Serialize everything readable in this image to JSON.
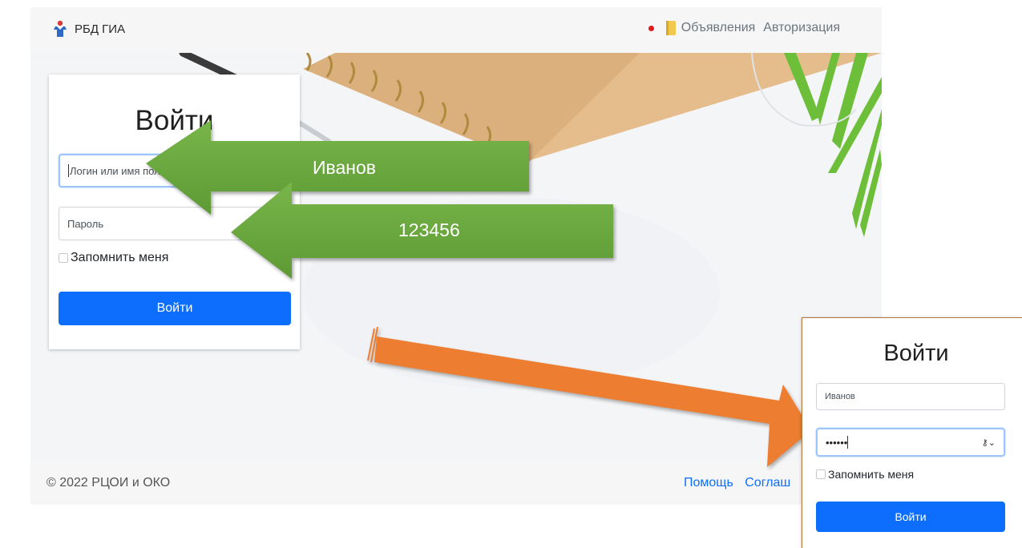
{
  "navbar": {
    "brand": "РБД ГИА",
    "links": [
      "Объявления",
      "Авторизация"
    ],
    "colors": {
      "dot": "#e21a1a",
      "link": "#6c757d"
    }
  },
  "login_card": {
    "title": "Войти",
    "login_placeholder": "Логин или имя пользователя",
    "password_placeholder": "Пароль",
    "remember": "Запомнить меня",
    "submit": "Войти"
  },
  "footer": {
    "copyright": "© 2022 РЦОИ и ОКО",
    "links": [
      "Помощь",
      "Соглаш"
    ]
  },
  "annotations": {
    "login_hint": "Иванов",
    "password_hint": "123456",
    "colors": {
      "green_arrow": "#6aa53f",
      "orange_arrow": "#ed7d31"
    }
  },
  "zoom_card": {
    "title": "Войти",
    "login_value": "Иванов",
    "password_mask": "••••••",
    "key_icon": "key-icon",
    "remember": "Запомнить меня",
    "submit": "Войти"
  },
  "accent": "#0d6efd"
}
